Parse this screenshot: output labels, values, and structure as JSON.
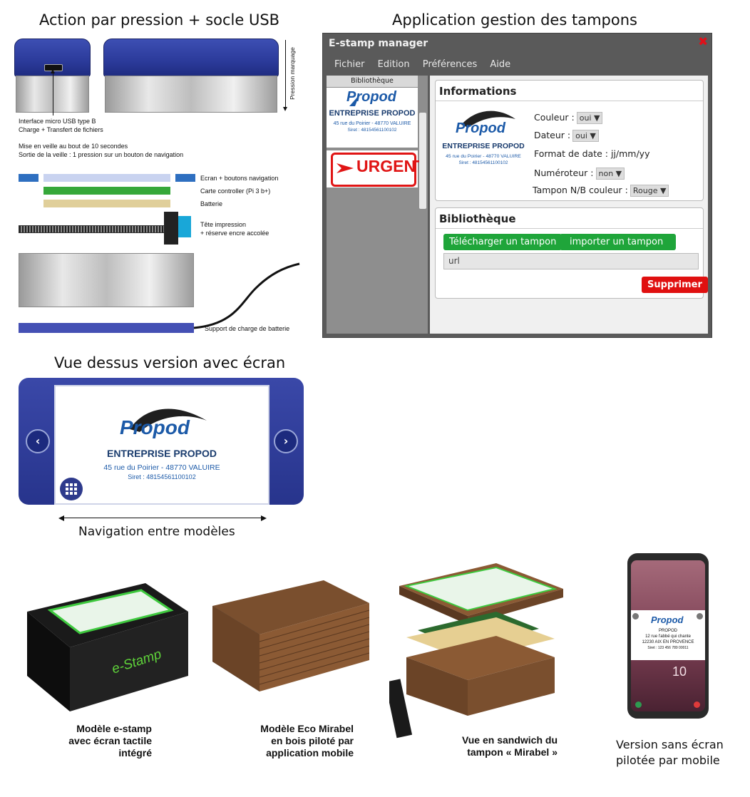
{
  "left_top": {
    "title": "Action par pression + socle USB",
    "pressure_label": "Pression marquage",
    "usb_note_1": "Interface micro USB type B",
    "usb_note_2": "Charge + Transfert de fichiers",
    "sleep_note_1": "Mise en veille au bout de 10 secondes",
    "sleep_note_2": "Sortie de la veille : 1 pression sur un bouton de navigation",
    "layers": [
      {
        "label": "Ecran + boutons navigation",
        "color": "#c9d3f0"
      },
      {
        "label": "Carte controller (Pi 3 b+)",
        "color": "#36a83a"
      },
      {
        "label": "Batterie",
        "color": "#e0cf9a"
      }
    ],
    "head_label_1": "Tête impression",
    "head_label_2": "+ réserve encre accolée",
    "charger_label": "Support de charge de batterie"
  },
  "app": {
    "section_title": "Application gestion des tampons",
    "window_title": "E-stamp manager",
    "close_icon": "close-icon",
    "menu": [
      "Fichier",
      "Edition",
      "Préférences",
      "Aide"
    ],
    "sidebar_title": "Bibliothèque",
    "stamp_urgent": "URGENT",
    "info_title": "Informations",
    "fields": {
      "couleur_label": "Couleur :",
      "couleur_value": "oui",
      "dateur_label": "Dateur :",
      "dateur_value": "oui",
      "format_label": "Format de date : jj/mm/yy",
      "numeroteur_label": "Numéroteur :",
      "numeroteur_value": "non",
      "tampon_label": "Tampon N/B couleur :",
      "tampon_value": "Rouge"
    },
    "library_title": "Bibliothèque",
    "download_button": "Télécharger un tampon",
    "import_button": "importer un tampon",
    "url_placeholder": "url",
    "delete_button": "Supprimer"
  },
  "stamp": {
    "brand": "Propod",
    "company": "ENTREPRISE PROPOD",
    "address": "45 rue du Poirier - 48770 VALUIRE",
    "siret": "Siret : 48154561100102"
  },
  "top_view": {
    "title": "Vue dessus version avec écran",
    "nav_label": "Navigation entre modèles"
  },
  "products": [
    {
      "caption_1": "Modèle e-stamp",
      "caption_2": "avec écran tactile",
      "caption_3": "intégré",
      "device_label": "e-Stamp"
    },
    {
      "caption_1": "Modèle Eco Mirabel",
      "caption_2": "en bois piloté par",
      "caption_3": "application mobile"
    },
    {
      "caption_1": "Vue en sandwich du",
      "caption_2": "tampon « Mirabel »"
    },
    {
      "caption_1": "Version sans écran",
      "caption_2": "pilotée par mobile"
    }
  ],
  "phone": {
    "brand": "Propod",
    "line1": "PROPOD",
    "line2": "12 rue l'abbé qui chante",
    "line3": "12230 AIX EN PROVENCE",
    "line4": "Siret : 123  456 789 00011",
    "number": "10"
  }
}
